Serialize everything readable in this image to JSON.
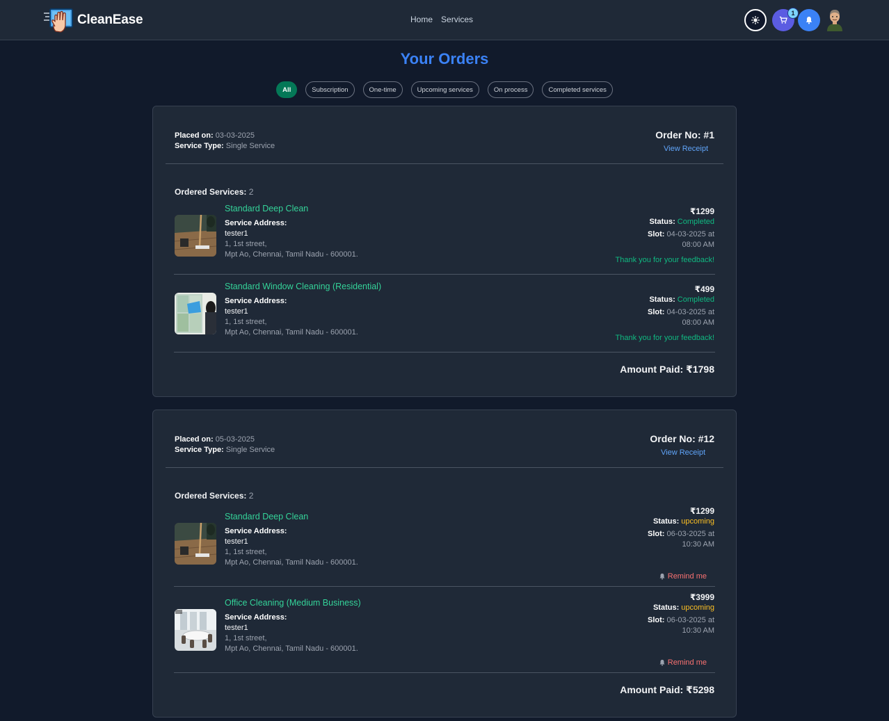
{
  "nav": {
    "brand": "CleanEase",
    "links": [
      "Home",
      "Services"
    ],
    "cart_count": "1"
  },
  "page": {
    "title": "Your Orders",
    "filters": [
      "All",
      "Subscription",
      "One-time",
      "Upcoming services",
      "On process",
      "Completed services"
    ],
    "active_filter": "All"
  },
  "labels": {
    "placed_on": "Placed on:",
    "service_type": "Service Type:",
    "ordered_services": "Ordered Services:",
    "service_address": "Service Address:",
    "status": "Status:",
    "slot": "Slot:",
    "view_receipt": "View Receipt",
    "amount_paid": "Amount Paid:",
    "thanks": "Thank you for your feedback!",
    "remind": "Remind me"
  },
  "orders": [
    {
      "placed_on": "03-03-2025",
      "service_type": "Single Service",
      "order_no": "Order No: #1",
      "service_count": "2",
      "amount_paid": "₹1798",
      "items": [
        {
          "name": "Standard Deep Clean",
          "contact": "tester1",
          "line1": "1, 1st street,",
          "line2": "Mpt Ao, Chennai, Tamil Nadu - 600001.",
          "price": "₹1299",
          "status": "Completed",
          "slot_date": "04-03-2025 at",
          "slot_time": "08:00 AM",
          "image": "floor-mopping-photo"
        },
        {
          "name": "Standard Window Cleaning (Residential)",
          "contact": "tester1",
          "line1": "1, 1st street,",
          "line2": "Mpt Ao, Chennai, Tamil Nadu - 600001.",
          "price": "₹499",
          "status": "Completed",
          "slot_date": "04-03-2025 at",
          "slot_time": "08:00 AM",
          "image": "window-cleaning-photo"
        }
      ]
    },
    {
      "placed_on": "05-03-2025",
      "service_type": "Single Service",
      "order_no": "Order No: #12",
      "service_count": "2",
      "amount_paid": "₹5298",
      "items": [
        {
          "name": "Standard Deep Clean",
          "contact": "tester1",
          "line1": "1, 1st street,",
          "line2": "Mpt Ao, Chennai, Tamil Nadu - 600001.",
          "price": "₹1299",
          "status": "upcoming",
          "slot_date": "06-03-2025 at",
          "slot_time": "10:30 AM",
          "image": "floor-mopping-photo"
        },
        {
          "name": "Office Cleaning (Medium Business)",
          "contact": "tester1",
          "line1": "1, 1st street,",
          "line2": "Mpt Ao, Chennai, Tamil Nadu - 600001.",
          "price": "₹3999",
          "status": "upcoming",
          "slot_date": "06-03-2025 at",
          "slot_time": "10:30 AM",
          "image": "office-room-photo"
        }
      ]
    }
  ],
  "colors": {
    "accent": "#3b82f6",
    "completed": "#10b981",
    "upcoming": "#fbbf24",
    "remind": "#f87171",
    "service_name": "#34d399"
  }
}
